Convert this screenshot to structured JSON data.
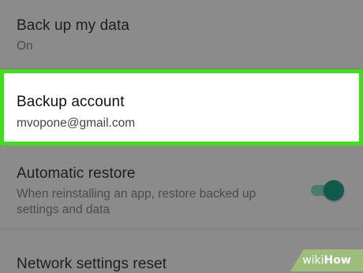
{
  "settings": {
    "backup_data": {
      "title": "Back up my data",
      "summary": "On"
    },
    "backup_account": {
      "title": "Backup account",
      "summary": "mvopone@gmail.com"
    },
    "automatic_restore": {
      "title": "Automatic restore",
      "summary": "When reinstalling an app, restore backed up settings and data",
      "enabled": true
    },
    "network_reset": {
      "title": "Network settings reset"
    }
  },
  "colors": {
    "highlight": "#3ee01a",
    "toggle_on": "#0f5a4a",
    "background": "#8b8b8b"
  },
  "watermark": {
    "part1": "wiki",
    "part2": "How"
  }
}
